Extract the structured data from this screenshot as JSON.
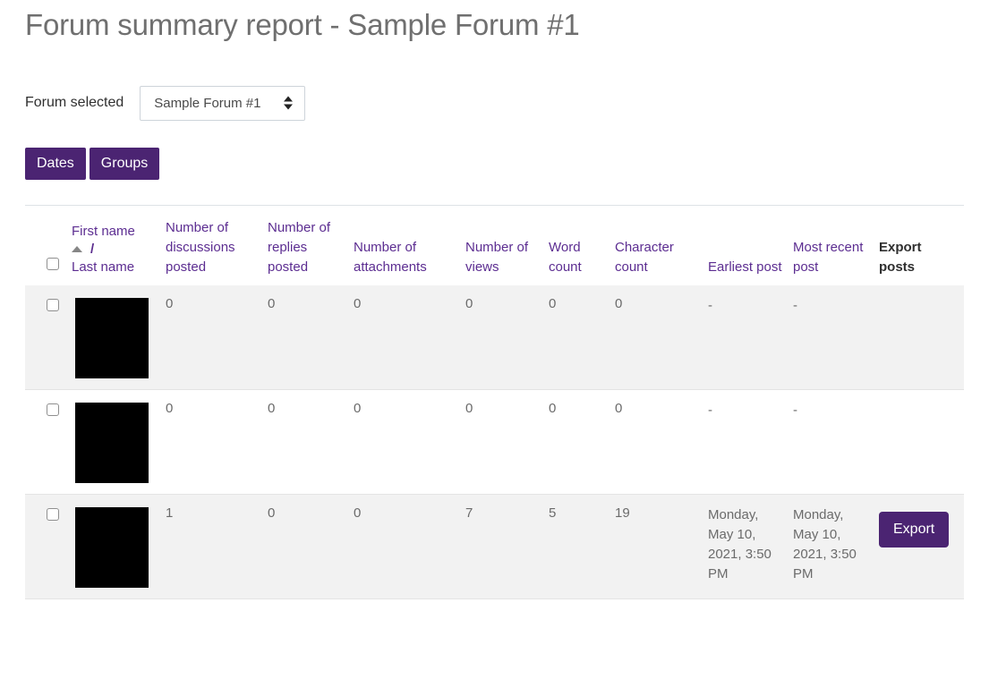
{
  "page": {
    "title": "Forum summary report - Sample Forum #1"
  },
  "filter": {
    "forum_label": "Forum selected",
    "forum_selected": "Sample Forum #1",
    "forum_options": [
      "Sample Forum #1"
    ],
    "select_icon": "updown-chevron-icon",
    "buttons": [
      {
        "label": "Dates",
        "name": "dates-button"
      },
      {
        "label": "Groups",
        "name": "groups-button"
      }
    ],
    "accent_color": "#4b2472"
  },
  "table": {
    "headers": {
      "select_all": "",
      "name": {
        "first": "First name",
        "separator": "/",
        "last": "Last name",
        "sort": "ascending",
        "sort_icon": "sort-asc-arrow-icon"
      },
      "discussions": "Number of discussions posted",
      "replies": "Number of replies posted",
      "attachments": "Number of attachments",
      "views": "Number of views",
      "word_count": "Word count",
      "char_count": "Character count",
      "earliest_post": "Earliest post",
      "recent_post": "Most recent post",
      "export_posts": "Export posts"
    },
    "header_link_color": "#5b2d8e",
    "rows": [
      {
        "name_redacted": true,
        "discussions": "0",
        "replies": "0",
        "attachments": "0",
        "views": "0",
        "word_count": "0",
        "char_count": "0",
        "earliest_post": "-",
        "recent_post": "-",
        "export_label": ""
      },
      {
        "name_redacted": true,
        "discussions": "0",
        "replies": "0",
        "attachments": "0",
        "views": "0",
        "word_count": "0",
        "char_count": "0",
        "earliest_post": "-",
        "recent_post": "-",
        "export_label": ""
      },
      {
        "name_redacted": true,
        "discussions": "1",
        "replies": "0",
        "attachments": "0",
        "views": "7",
        "word_count": "5",
        "char_count": "19",
        "earliest_post": "Monday, May 10, 2021, 3:50 PM",
        "recent_post": "Monday, May 10, 2021, 3:50 PM",
        "export_label": "Export"
      }
    ]
  }
}
